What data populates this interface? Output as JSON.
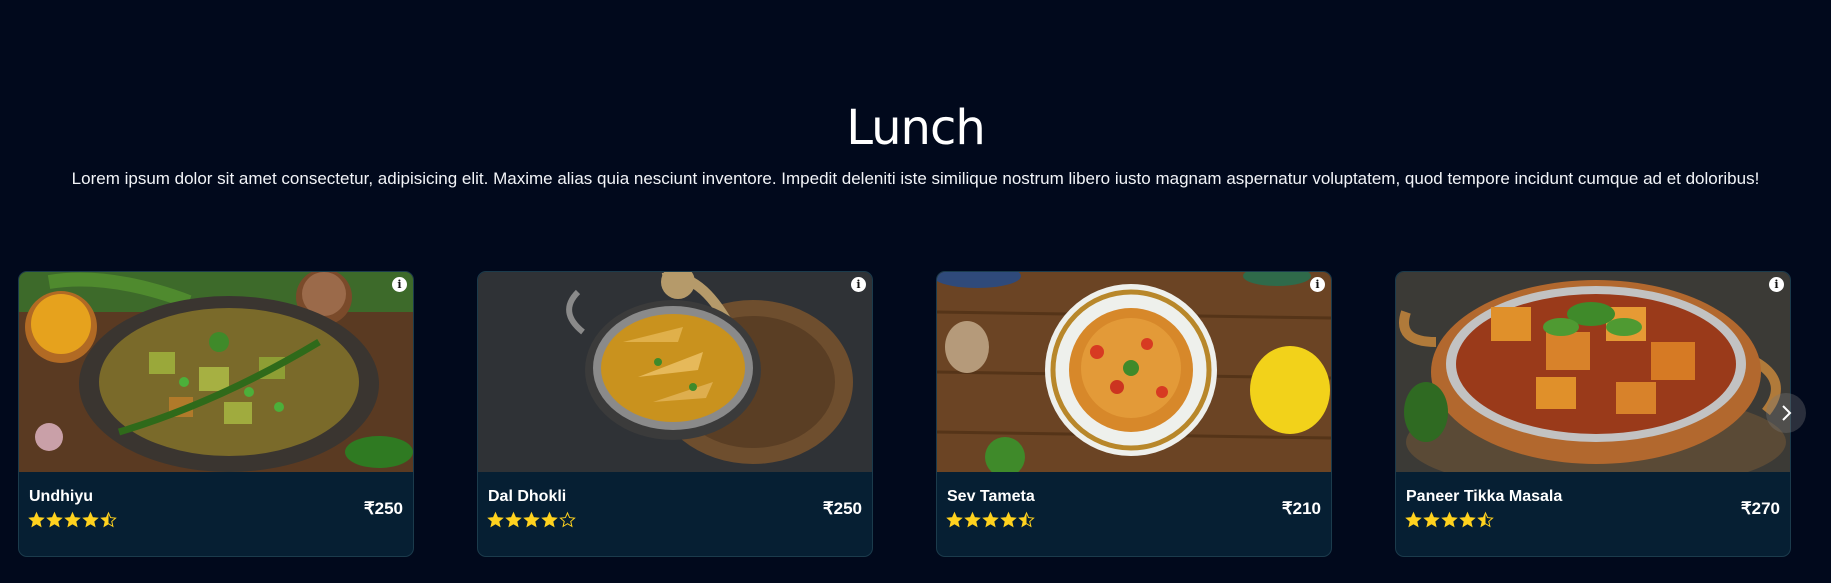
{
  "section": {
    "title": "Lunch",
    "description": "Lorem ipsum dolor sit amet consectetur, adipisicing elit. Maxime alias quia nesciunt inventore. Impedit deleniti iste similique nostrum libero iusto magnam aspernatur voluptatem, quod tempore incidunt cumque ad et doloribus!"
  },
  "colors": {
    "background": "#01091c",
    "card_background": "#061f33",
    "star": "#ffd21f",
    "text": "#ffffff"
  },
  "cards": [
    {
      "name": "Undhiyu",
      "price": "₹250",
      "rating": 4.5,
      "image": "undhiyu-bowl-image"
    },
    {
      "name": "Dal Dhokli",
      "price": "₹250",
      "rating": 4,
      "image": "dal-dhokli-pot-image"
    },
    {
      "name": "Sev Tameta",
      "price": "₹210",
      "rating": 4.5,
      "image": "sev-tameta-plate-image"
    },
    {
      "name": "Paneer Tikka Masala",
      "price": "₹270",
      "rating": 4.5,
      "image": "paneer-tikka-pan-image"
    }
  ],
  "icons": {
    "info": "info-icon",
    "next": "chevron-right-icon",
    "star": "star-icon"
  }
}
